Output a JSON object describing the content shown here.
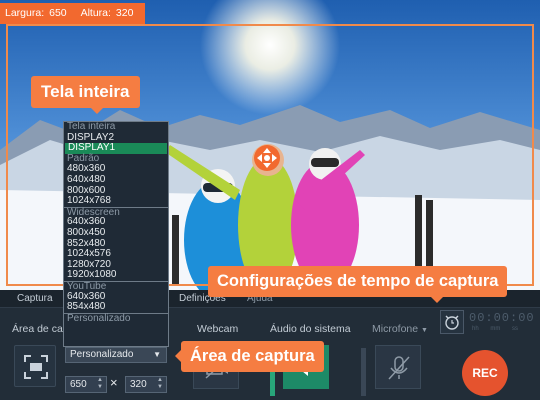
{
  "capture_size": {
    "width_label": "Largura:",
    "width_value": "650",
    "height_label": "Altura:",
    "height_value": "320"
  },
  "callouts": {
    "full_screen": "Tela inteira",
    "capture_time": "Configurações de tempo de captura",
    "capture_area": "Área de captura"
  },
  "tabs": {
    "capture": "Captura",
    "settings": "Definições",
    "help": "Ajuda"
  },
  "panel": {
    "area_label": "Área de cap",
    "webcam_label": "Webcam",
    "system_audio_label": "Áudio do sistema",
    "microphone_label": "Microfone",
    "preset_value": "Personalizado",
    "width_value": "650",
    "height_value": "320",
    "times_symbol": "×"
  },
  "timer": {
    "display": "00:00:00",
    "units": "hh mm ss"
  },
  "rec_label": "REC",
  "dropdown": [
    {
      "text": "Tela inteira",
      "kind": "header"
    },
    {
      "text": "DISPLAY2",
      "kind": "item"
    },
    {
      "text": "DISPLAY1",
      "kind": "selected"
    },
    {
      "text": "Padrão",
      "kind": "header"
    },
    {
      "text": "480x360",
      "kind": "item"
    },
    {
      "text": "640x480",
      "kind": "item"
    },
    {
      "text": "800x600",
      "kind": "item"
    },
    {
      "text": "1024x768",
      "kind": "item"
    },
    {
      "text": "Widescreen",
      "kind": "header-line"
    },
    {
      "text": "640x360",
      "kind": "item"
    },
    {
      "text": "800x450",
      "kind": "item"
    },
    {
      "text": "852x480",
      "kind": "item"
    },
    {
      "text": "1024x576",
      "kind": "item"
    },
    {
      "text": "1280x720",
      "kind": "item"
    },
    {
      "text": "1920x1080",
      "kind": "item"
    },
    {
      "text": "YouTube",
      "kind": "header-line"
    },
    {
      "text": "640x360",
      "kind": "item"
    },
    {
      "text": "854x480",
      "kind": "item"
    },
    {
      "text": "Personalizado",
      "kind": "header-line"
    }
  ],
  "colors": {
    "accent": "#f2692f",
    "selected": "#1a8a58",
    "audio_active": "#1d8a67",
    "rec": "#e5532e"
  },
  "audio_level": 0.55
}
